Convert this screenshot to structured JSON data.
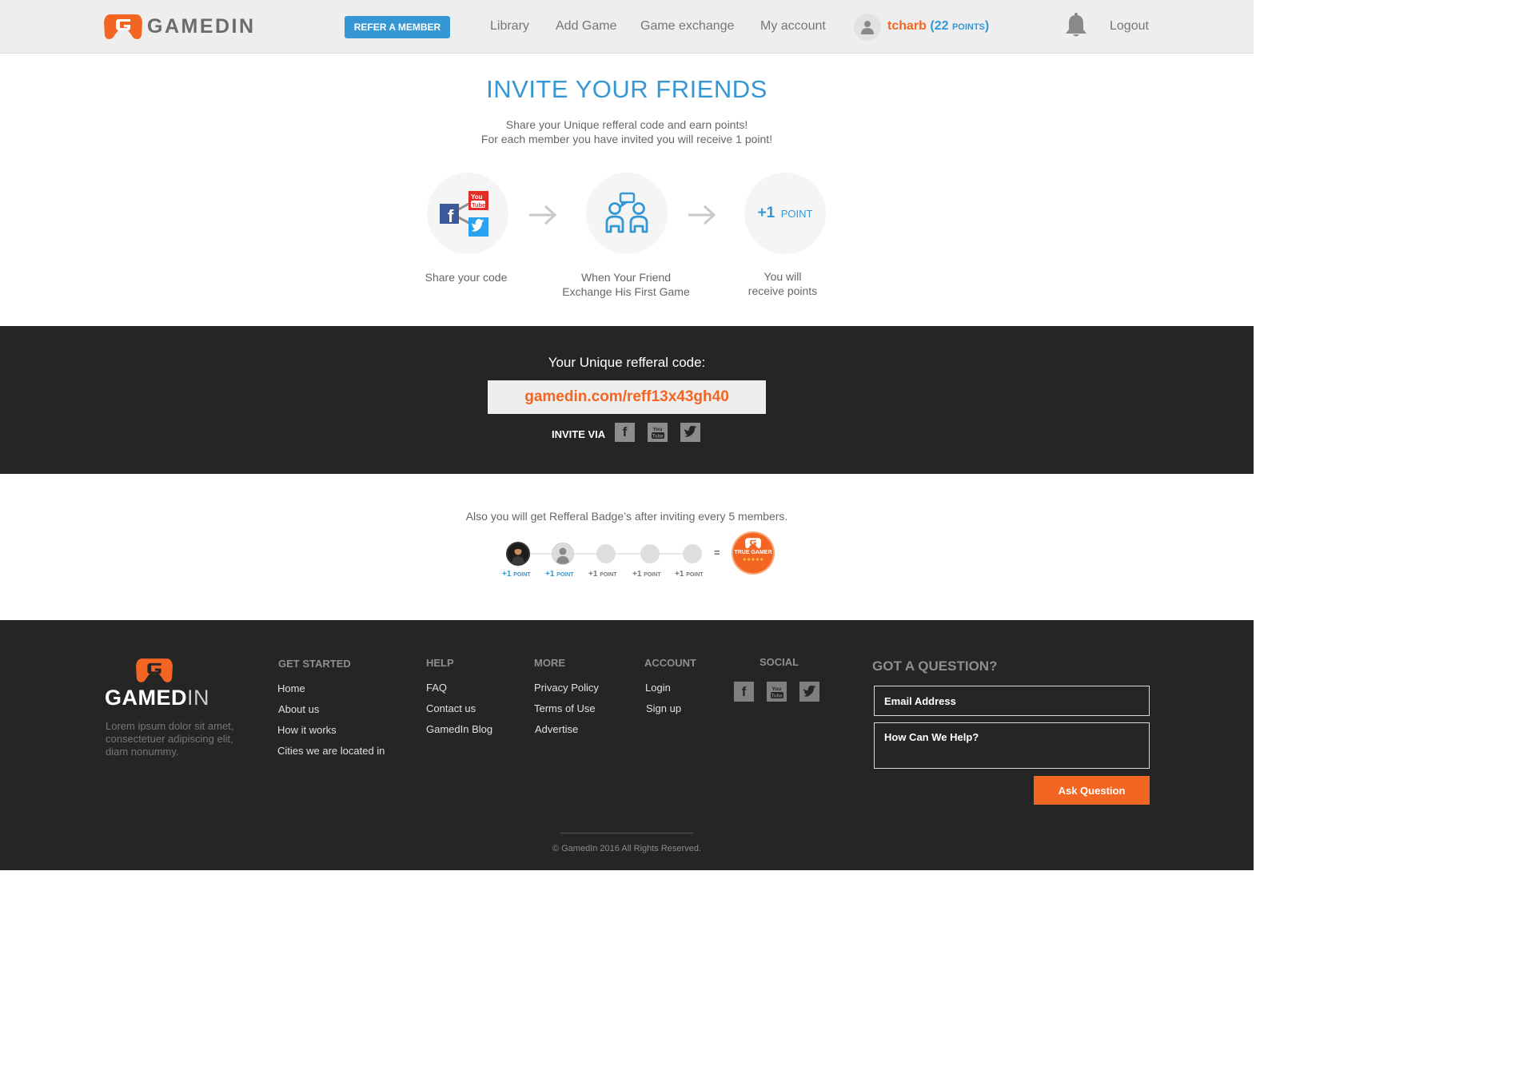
{
  "header": {
    "brand": "GAMEDIN",
    "refer_button": "REFER A MEMBER",
    "nav": [
      "Library",
      "Add Game",
      "Game exchange",
      "My account"
    ],
    "username": "tcharb",
    "points_open": "(22",
    "points_unit": "POINTS",
    "points_close": ")",
    "logout": "Logout"
  },
  "invite": {
    "title": "INVITE YOUR FRIENDS",
    "subtitle_line1": "Share your Unique refferal code and earn points!",
    "subtitle_line2": "For each member you have invited you will receive 1 point!",
    "steps": [
      {
        "icon": "share-networks-icon",
        "caption_line1": "Share your code",
        "caption_line2": ""
      },
      {
        "icon": "friends-icon",
        "caption_line1": "When Your Friend",
        "caption_line2": "Exchange His First Game"
      },
      {
        "icon": "plus-point-icon",
        "value": "+1",
        "unit": "POINT",
        "caption_line1": "You will",
        "caption_line2": "receive points"
      }
    ]
  },
  "referral": {
    "label": "Your Unique refferal code:",
    "code": "gamedin.com/reff13x43gh40",
    "invite_via": "INVITE VIA"
  },
  "badges": {
    "text": "Also you will get Refferal Badge’s after inviting every 5 members.",
    "progress": [
      {
        "value": "+1",
        "unit": "POINT",
        "state": "earned"
      },
      {
        "value": "+1",
        "unit": "POINT",
        "state": "earned"
      },
      {
        "value": "+1",
        "unit": "POINT",
        "state": "pending"
      },
      {
        "value": "+1",
        "unit": "POINT",
        "state": "pending"
      },
      {
        "value": "+1",
        "unit": "POINT",
        "state": "pending"
      }
    ],
    "equals": "=",
    "badge_label": "TRUE GAMER",
    "badge_stars": "★★★★★"
  },
  "footer": {
    "brand_main": "GAMED",
    "brand_in": "IN",
    "lorem": "Lorem ipsum dolor sit amet, consectetuer adipiscing elit, diam nonummy.",
    "columns": {
      "get_started": {
        "title": "GET STARTED",
        "links": [
          "Home",
          "About us",
          "How it works",
          "Cities we are located in"
        ]
      },
      "help": {
        "title": "HELP",
        "links": [
          "FAQ",
          "Contact us",
          "GamedIn Blog"
        ]
      },
      "more": {
        "title": "MORE",
        "links": [
          "Privacy Policy",
          "Terms of Use",
          "Advertise"
        ]
      },
      "account": {
        "title": "ACCOUNT",
        "links": [
          "Login",
          "Sign up"
        ]
      },
      "social": {
        "title": "SOCIAL"
      }
    },
    "question": {
      "title": "GOT A QUESTION?",
      "email_placeholder": "Email Address",
      "help_placeholder": "How Can We Help?",
      "button": "Ask Question"
    },
    "copyright": "© GamedIn 2016 All Rights Reserved."
  },
  "colors": {
    "accent_orange": "#f26522",
    "accent_blue": "#3597d3",
    "dark_band": "#252525",
    "header_bg": "#eeeeee"
  }
}
